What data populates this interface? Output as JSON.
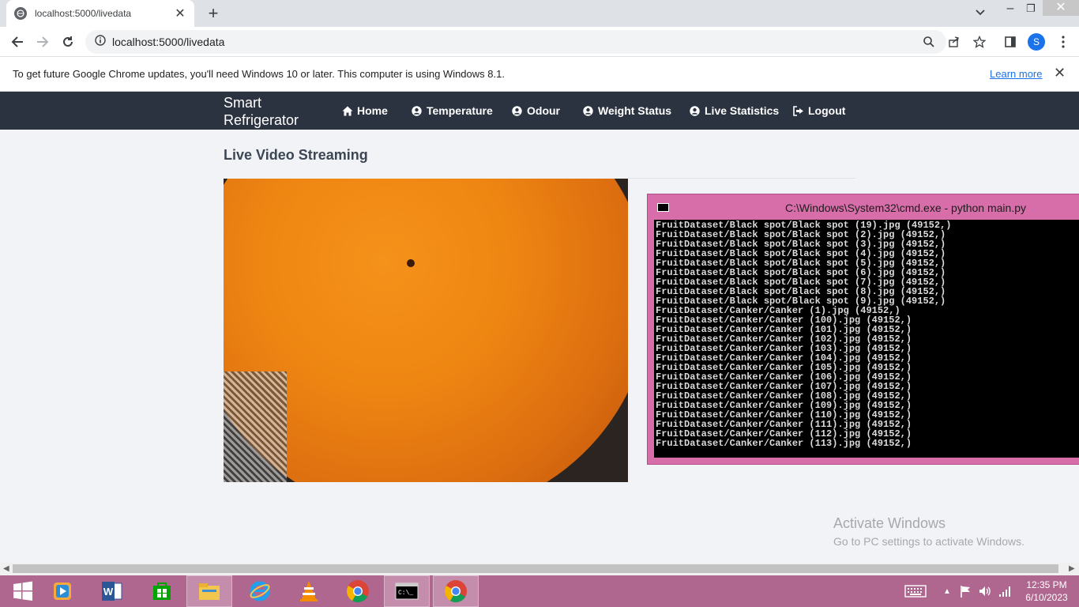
{
  "browser": {
    "tab_title": "localhost:5000/livedata",
    "url": "localhost:5000/livedata",
    "profile_initial": "S",
    "infobar_text": "To get future Google Chrome updates, you'll need Windows 10 or later. This computer is using Windows 8.1.",
    "infobar_link": "Learn more"
  },
  "navbar": {
    "brand_line1": "Smart",
    "brand_line2": "Refrigerator",
    "items": [
      {
        "label": "Home",
        "icon": "home-icon"
      },
      {
        "label": "Temperature",
        "icon": "user-circle-icon"
      },
      {
        "label": "Odour",
        "icon": "user-circle-icon"
      },
      {
        "label": "Weight Status",
        "icon": "user-circle-icon"
      },
      {
        "label": "Live Statistics",
        "icon": "user-circle-icon"
      },
      {
        "label": "Logout",
        "icon": "logout-icon"
      }
    ]
  },
  "main": {
    "title": "Live Video Streaming"
  },
  "cmd": {
    "title": "C:\\Windows\\System32\\cmd.exe - python  main.py",
    "lines": [
      "FruitDataset/Black spot/Black spot (19).jpg (49152,)",
      "FruitDataset/Black spot/Black spot (2).jpg (49152,)",
      "FruitDataset/Black spot/Black spot (3).jpg (49152,)",
      "FruitDataset/Black spot/Black spot (4).jpg (49152,)",
      "FruitDataset/Black spot/Black spot (5).jpg (49152,)",
      "FruitDataset/Black spot/Black spot (6).jpg (49152,)",
      "FruitDataset/Black spot/Black spot (7).jpg (49152,)",
      "FruitDataset/Black spot/Black spot (8).jpg (49152,)",
      "FruitDataset/Black spot/Black spot (9).jpg (49152,)",
      "FruitDataset/Canker/Canker (1).jpg (49152,)",
      "FruitDataset/Canker/Canker (100).jpg (49152,)",
      "FruitDataset/Canker/Canker (101).jpg (49152,)",
      "FruitDataset/Canker/Canker (102).jpg (49152,)",
      "FruitDataset/Canker/Canker (103).jpg (49152,)",
      "FruitDataset/Canker/Canker (104).jpg (49152,)",
      "FruitDataset/Canker/Canker (105).jpg (49152,)",
      "FruitDataset/Canker/Canker (106).jpg (49152,)",
      "FruitDataset/Canker/Canker (107).jpg (49152,)",
      "FruitDataset/Canker/Canker (108).jpg (49152,)",
      "FruitDataset/Canker/Canker (109).jpg (49152,)",
      "FruitDataset/Canker/Canker (110).jpg (49152,)",
      "FruitDataset/Canker/Canker (111).jpg (49152,)",
      "FruitDataset/Canker/Canker (112).jpg (49152,)",
      "FruitDataset/Canker/Canker (113).jpg (49152,)"
    ]
  },
  "watermark": {
    "line1": "Activate Windows",
    "line2": "Go to PC settings to activate Windows."
  },
  "taskbar": {
    "time": "12:35 PM",
    "date": "6/10/2023",
    "apps": [
      "windows-start-icon",
      "media-player-icon",
      "word-icon",
      "store-icon",
      "file-explorer-icon",
      "internet-explorer-icon",
      "vlc-icon",
      "chrome-icon",
      "cmd-icon",
      "chrome-icon"
    ]
  },
  "colors": {
    "navbar": "#2c3340",
    "taskbar": "#b0678f",
    "cmd_frame": "#d76ea9",
    "link": "#1a73e8"
  }
}
